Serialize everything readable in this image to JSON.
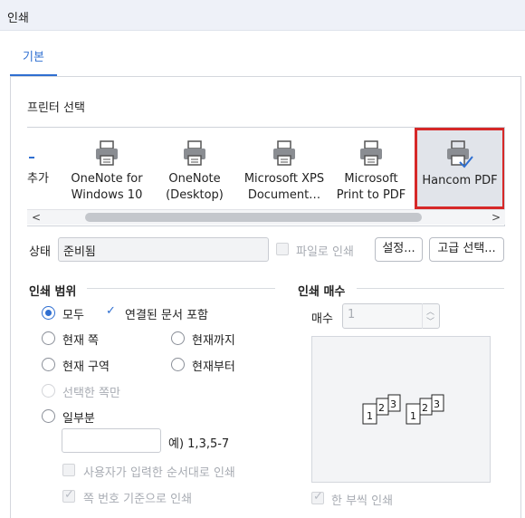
{
  "window": {
    "title": "인쇄"
  },
  "tabs": {
    "basic": "기본"
  },
  "printer_select": {
    "label": "프린터 선택",
    "add_label": "추가",
    "printers": [
      {
        "line1": "OneNote for",
        "line2": "Windows 10"
      },
      {
        "line1": "OneNote",
        "line2": "(Desktop)"
      },
      {
        "line1": "Microsoft XPS",
        "line2": "Document…"
      },
      {
        "line1": "Microsoft",
        "line2": "Print to PDF"
      },
      {
        "line1": "Hancom PDF",
        "line2": ""
      }
    ],
    "selected": "Hancom PDF",
    "scroll_left": "<",
    "scroll_right": ">"
  },
  "status": {
    "label": "상태",
    "value": "준비됨",
    "file_print": "파일로 인쇄",
    "settings_button": "설정...",
    "advanced_button": "고급 선택..."
  },
  "print_range": {
    "title": "인쇄 범위",
    "all": "모두",
    "linked_docs": "연결된 문서 포함",
    "current_page": "현재 쪽",
    "up_to_current": "현재까지",
    "current_section": "현재 구역",
    "from_current": "현재부터",
    "selected_pages": "선택한 쪽만",
    "some_pages": "일부분",
    "example": "예) 1,3,5-7",
    "user_order": "사용자가 입력한 순서대로 인쇄",
    "page_number_based": "쪽 번호 기준으로 인쇄"
  },
  "copies": {
    "title": "인쇄 매수",
    "label": "매수",
    "value": "1",
    "collate": "한 부씩 인쇄"
  }
}
